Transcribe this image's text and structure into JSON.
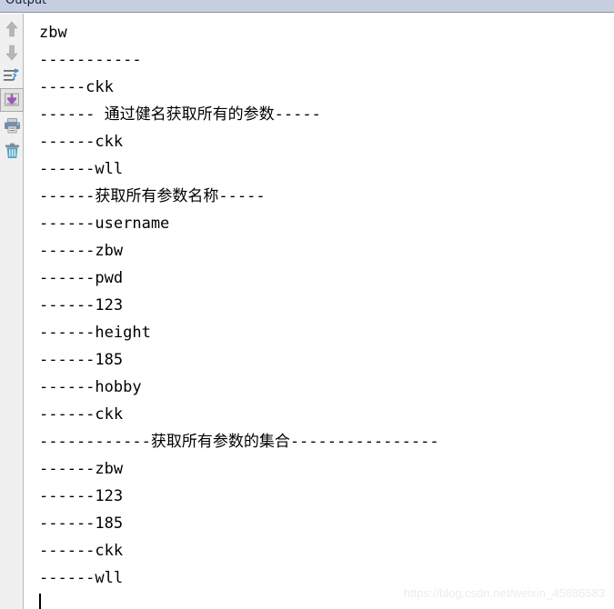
{
  "window": {
    "tab_label": "Output"
  },
  "toolbar": {
    "buttons": [
      {
        "name": "scroll-up-button",
        "icon": "arrow-up-icon",
        "tooltip": "Previous Error",
        "selected": false
      },
      {
        "name": "scroll-down-button",
        "icon": "arrow-down-icon",
        "tooltip": "Next Error",
        "selected": false
      },
      {
        "name": "wrap-text-button",
        "icon": "wrap-text-icon",
        "tooltip": "Wrap Text",
        "selected": false
      },
      {
        "name": "scroll-to-end-button",
        "icon": "scroll-to-end-icon",
        "tooltip": "Scroll to End",
        "selected": true
      },
      {
        "name": "print-output-button",
        "icon": "printer-icon",
        "tooltip": "Print",
        "selected": false
      },
      {
        "name": "clear-output-button",
        "icon": "trash-icon",
        "tooltip": "Clear",
        "selected": false
      }
    ]
  },
  "output": {
    "lines": [
      "zbw",
      "-----------",
      "-----ckk",
      "------ 通过健名获取所有的参数-----",
      "------ckk",
      "------wll",
      "------获取所有参数名称-----",
      "------username",
      "------zbw",
      "------pwd",
      "------123",
      "------height",
      "------185",
      "------hobby",
      "------ckk",
      "------------获取所有参数的集合----------------",
      "------zbw",
      "------123",
      "------185",
      "------ckk",
      "------wll"
    ]
  },
  "watermark": {
    "text": "https://blog.csdn.net/weixin_45686583"
  },
  "colors": {
    "tabstrip_bg": "#c5cfe0",
    "toolbar_bg": "#f0f0f0",
    "output_bg": "#ffffff",
    "text": "#000000",
    "accent_purple": "#9b59b6",
    "accent_blue": "#3d87c9"
  }
}
